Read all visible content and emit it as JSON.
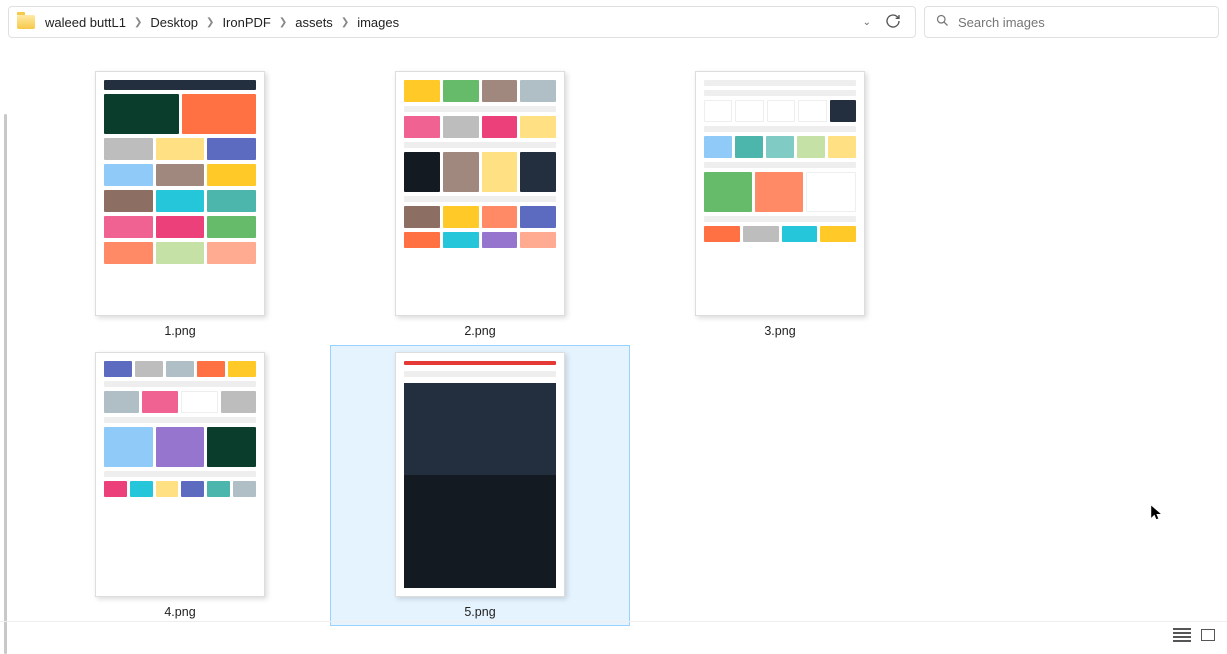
{
  "breadcrumbs": [
    "waleed buttL1",
    "Desktop",
    "IronPDF",
    "assets",
    "images"
  ],
  "search": {
    "placeholder": "Search images"
  },
  "files": [
    {
      "name": "1.png",
      "selected": false,
      "kind": "amazon-home"
    },
    {
      "name": "2.png",
      "selected": false,
      "kind": "amazon-grid"
    },
    {
      "name": "3.png",
      "selected": false,
      "kind": "amazon-intl"
    },
    {
      "name": "4.png",
      "selected": false,
      "kind": "amazon-elec"
    },
    {
      "name": "5.png",
      "selected": true,
      "kind": "amazon-footer"
    }
  ]
}
